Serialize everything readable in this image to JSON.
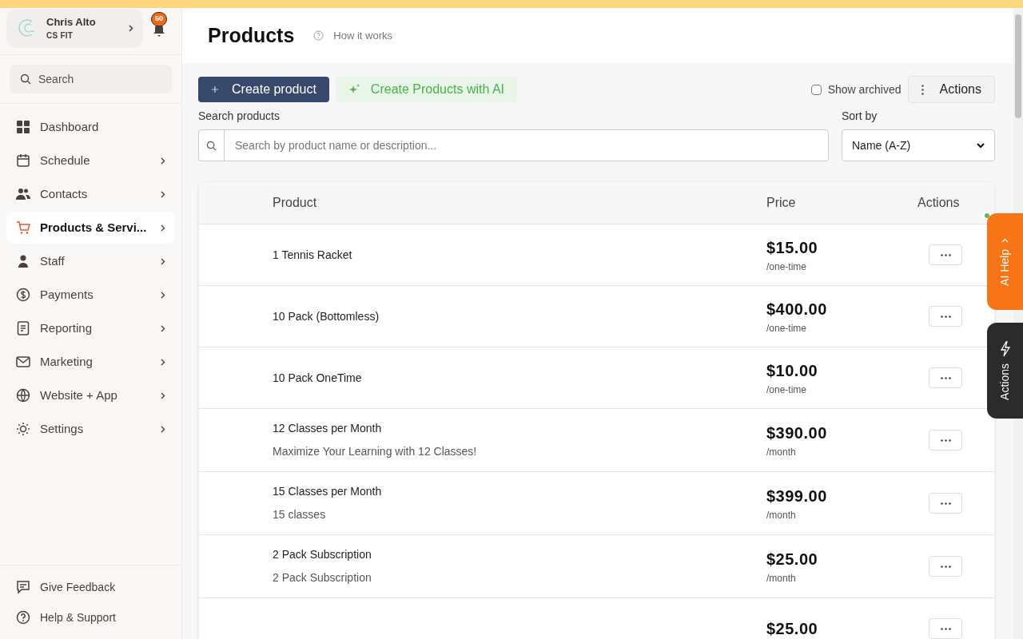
{
  "account": {
    "name": "Chris Alto",
    "org": "CS FIT"
  },
  "notifications": {
    "count": "50"
  },
  "sidebar": {
    "search": {
      "placeholder": "Search"
    },
    "items": [
      {
        "label": "Dashboard",
        "has_submenu": false,
        "selected": false
      },
      {
        "label": "Schedule",
        "has_submenu": true,
        "selected": false
      },
      {
        "label": "Contacts",
        "has_submenu": true,
        "selected": false
      },
      {
        "label": "Products & Servi...",
        "has_submenu": true,
        "selected": true
      },
      {
        "label": "Staff",
        "has_submenu": true,
        "selected": false
      },
      {
        "label": "Payments",
        "has_submenu": true,
        "selected": false
      },
      {
        "label": "Reporting",
        "has_submenu": true,
        "selected": false
      },
      {
        "label": "Marketing",
        "has_submenu": true,
        "selected": false
      },
      {
        "label": "Website + App",
        "has_submenu": true,
        "selected": false
      },
      {
        "label": "Settings",
        "has_submenu": true,
        "selected": false
      }
    ],
    "footer": [
      {
        "label": "Give Feedback"
      },
      {
        "label": "Help & Support"
      }
    ]
  },
  "page": {
    "title": "Products",
    "help_link": "How it works"
  },
  "toolbar": {
    "create": "Create product",
    "create_ai": "Create Products with AI",
    "show_archived": {
      "label": "Show archived",
      "checked": false
    },
    "actions": "Actions"
  },
  "search": {
    "label": "Search products",
    "placeholder": "Search by product name or description..."
  },
  "sort": {
    "label": "Sort by",
    "value": "Name (A-Z)"
  },
  "table": {
    "columns": [
      "Product",
      "Price",
      "Actions"
    ],
    "rows": [
      {
        "name": "1 Tennis Racket",
        "price": "$15.00",
        "period": "/one-time"
      },
      {
        "name": "10 Pack (Bottomless)",
        "price": "$400.00",
        "period": "/one-time"
      },
      {
        "name": "10 Pack OneTime",
        "price": "$10.00",
        "period": "/one-time"
      },
      {
        "name": "12 Classes per Month",
        "description": "Maximize Your Learning with 12 Classes!",
        "price": "$390.00",
        "period": "/month"
      },
      {
        "name": "15 Classes per Month",
        "description": "15 classes",
        "price": "$399.00",
        "period": "/month"
      },
      {
        "name": "2 Pack Subscription",
        "description": "2 Pack Subscription",
        "price": "$25.00",
        "period": "/month"
      },
      {
        "price": "$25.00"
      }
    ]
  },
  "side_tabs": [
    {
      "label": "AI Help",
      "kind": "help"
    },
    {
      "label": "Actions",
      "kind": "actions"
    }
  ]
}
